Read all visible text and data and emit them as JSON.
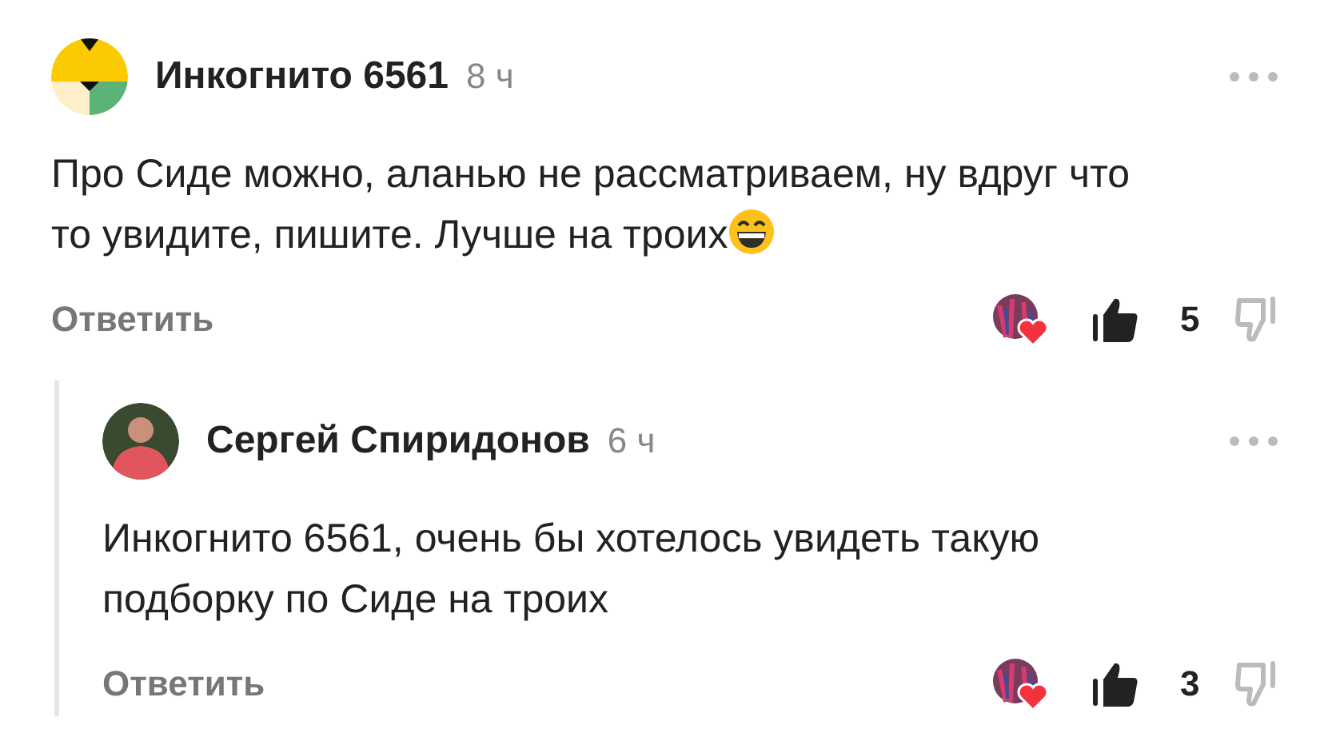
{
  "comments": [
    {
      "author": "Инкогнито 6561",
      "time": "8 ч",
      "avatar": {
        "kind": "pattern"
      },
      "text": "Про Сиде можно, аланью не рассматриваем, ну вдруг что то увидите, пишите. Лучше на троих",
      "emoji": true,
      "reply_label": "Ответить",
      "likes": "5",
      "liked": true,
      "replies": [
        {
          "author": "Сергей Спиридонов",
          "time": "6 ч",
          "avatar": {
            "kind": "photo"
          },
          "text": "Инкогнито 6561, очень бы хотелось увидеть такую подборку по Сиде на троих",
          "emoji": false,
          "reply_label": "Ответить",
          "likes": "3",
          "liked": true
        }
      ]
    }
  ]
}
